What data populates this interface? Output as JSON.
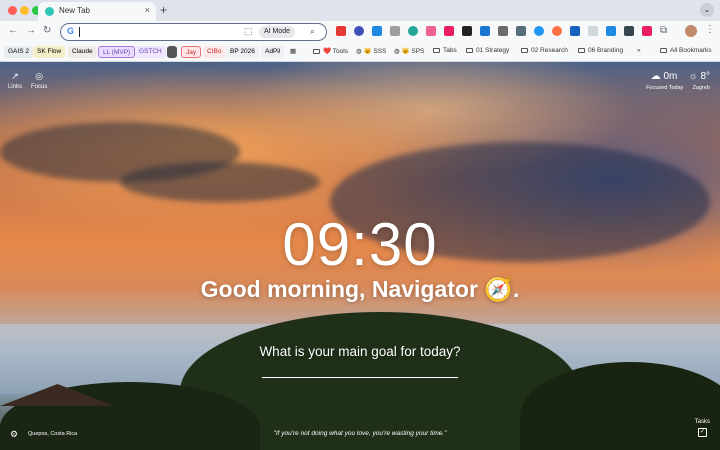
{
  "tab": {
    "title": "New Tab",
    "close": "×",
    "new": "+"
  },
  "window": {
    "tabs_menu": "⌄"
  },
  "toolbar": {
    "back": "←",
    "forward": "→",
    "reload": "↻",
    "search_placeholder": "",
    "ai_mode_label": "AI Mode",
    "extensions_icon": "⧉",
    "menu": "⋮"
  },
  "bookmarks": {
    "chips": [
      {
        "label": "GAIS 2",
        "color": "#e9ecef"
      },
      {
        "label": "SK Flow",
        "color": "#f3f0c9"
      },
      {
        "label": "Claude",
        "color": "#f1ece6"
      },
      {
        "label": "LL (MVP)",
        "color": "#eadcff"
      },
      {
        "label": "GSTCH",
        "color": "#efe6ff"
      },
      {
        "label": "Jay",
        "color": "#ffe4e8"
      },
      {
        "label": "CIBo",
        "color": "#fde7e7"
      },
      {
        "label": "BP 2026",
        "color": "#eef0f3"
      },
      {
        "label": "AdPil",
        "color": "#eef0f3"
      }
    ],
    "links": [
      {
        "label": "❤️ Tools"
      },
      {
        "label": "🐱 SSS"
      },
      {
        "label": "🐱 SPS"
      },
      {
        "label": "Tabs"
      },
      {
        "label": "01 Strategy"
      },
      {
        "label": "02 Research"
      },
      {
        "label": "06 Branding"
      }
    ],
    "overflow": "»",
    "all_bookmarks": "All Bookmarks"
  },
  "page": {
    "links_label": "Links",
    "focus_label": "Focus",
    "weather": {
      "focus_time": "0m",
      "focus_label": "Focused Today",
      "temp": "8°",
      "city": "Zagreb"
    },
    "clock": "09:30",
    "greeting": "Good morning, Navigator 🧭.",
    "goal_question": "What is your main goal for today?",
    "location": "Quepos, Costa Rica",
    "quote": "\"If you're not doing what you love, you're wasting your time.\"",
    "tasks_label": "Tasks"
  },
  "colors": {
    "accent": "#5f6f8f",
    "omnibox_border": "#5f6f8f"
  }
}
